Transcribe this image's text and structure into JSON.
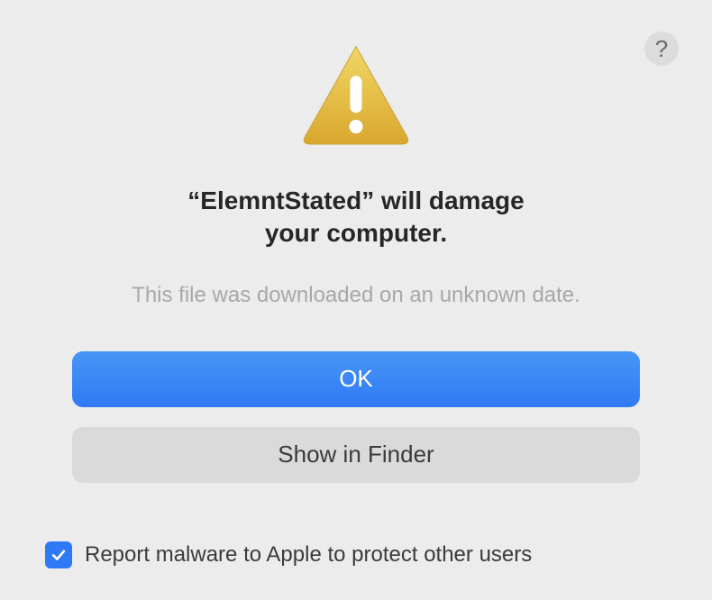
{
  "dialog": {
    "title_line1": "“ElemntStated” will damage",
    "title_line2": "your computer.",
    "subtitle": "This file was downloaded on an unknown date.",
    "help_label": "?",
    "buttons": {
      "primary": "OK",
      "secondary": "Show in Finder"
    },
    "checkbox": {
      "checked": true,
      "label": "Report malware to Apple to protect other users"
    },
    "icon": "warning-triangle"
  }
}
